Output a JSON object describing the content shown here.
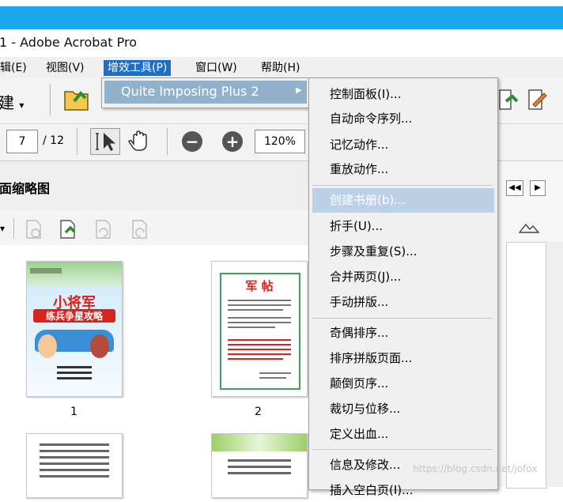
{
  "window": {
    "title": "1 - Adobe Acrobat Pro",
    "titlebar_color": "#1aa7ec"
  },
  "menubar": {
    "items": [
      {
        "label": "辑(E)",
        "underline": "E"
      },
      {
        "label": "视图(V)",
        "underline": "V"
      },
      {
        "label": "增效工具(P)",
        "underline": "P",
        "active": true
      },
      {
        "label": "窗口(W)",
        "underline": "W"
      },
      {
        "label": "帮助(H)",
        "underline": "H"
      }
    ],
    "active_color": "#1c6fc5"
  },
  "toolbar": {
    "create_label": "建",
    "page_current": "7",
    "page_total": "/ 12",
    "zoom": "120%"
  },
  "panel": {
    "title": "缩略图",
    "title_prefix": "面",
    "thumbnails": [
      {
        "page": "1"
      },
      {
        "page": "2"
      }
    ],
    "thumb1_headline": "小将军",
    "thumb1_sub": "练兵争星攻略",
    "thumb2_headline": "军 帖"
  },
  "submenu_plugins": {
    "item": "Quite Imposing Plus 2",
    "arrow": "▶"
  },
  "submenu_qi": {
    "items": [
      {
        "label": "控制面板(I)..."
      },
      {
        "label": "自动命令序列..."
      },
      {
        "label": "记忆动作..."
      },
      {
        "label": "重放动作..."
      },
      {
        "label": "创建书册(b)...",
        "highlight": true
      },
      {
        "label": "折手(U)..."
      },
      {
        "label": "步骤及重复(S)..."
      },
      {
        "label": "合并两页(J)..."
      },
      {
        "label": "手动拼版..."
      },
      {
        "label": "奇偶排序..."
      },
      {
        "label": "排序拼版页面..."
      },
      {
        "label": "颠倒页序..."
      },
      {
        "label": "裁切与位移..."
      },
      {
        "label": "定义出血..."
      },
      {
        "label": "信息及修改..."
      },
      {
        "label": "插入空白页(I)..."
      }
    ]
  },
  "watermark": "https://blog.csdn.net/jofox"
}
